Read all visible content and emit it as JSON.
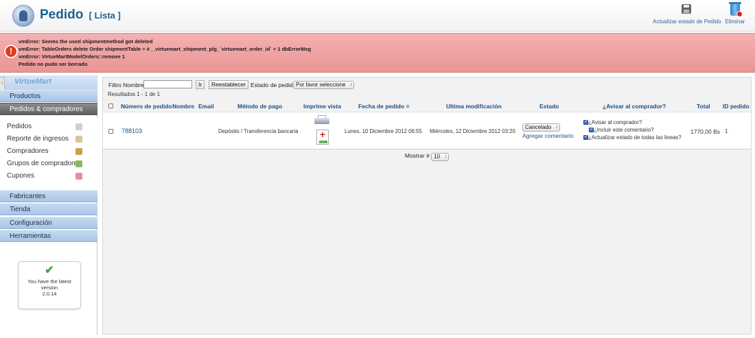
{
  "header": {
    "title": "Pedido",
    "subtitle": "[ Lista ]",
    "toolbar": {
      "update_label": "Actualizar estado de Pedido",
      "delete_label": "Eliminar"
    }
  },
  "errors": {
    "lines": [
      "vmError: Seems the used shipmentmethod got deleted",
      "vmError: TableOrders delete Order shipmentTable = #__virtuemart_shipment_plg_`virtuemart_order_id` = 1 dbErrorMsg",
      "vmError: VirtueMartModelOrders::remove 1",
      "Pedido no pudo ser borrado"
    ],
    "icon": "error-icon"
  },
  "sidebar": {
    "logo_text": "VirtueMart",
    "menus": [
      {
        "label": "Productos"
      },
      {
        "label": "Pedidos & compradores"
      },
      {
        "label": "Fabricantes"
      },
      {
        "label": "Tienda"
      },
      {
        "label": "Configuración"
      },
      {
        "label": "Herramientas"
      }
    ],
    "sub_items": [
      {
        "label": "Pedidos",
        "icon": "orders-icon",
        "color": "#c9c9c9"
      },
      {
        "label": "Reporte de ingresos",
        "icon": "report-icon",
        "color": "#d8c79a"
      },
      {
        "label": "Compradores",
        "icon": "users-icon",
        "color": "#c9a04a"
      },
      {
        "label": "Grupos de compradores",
        "icon": "group-icon",
        "color": "#8fb85a"
      },
      {
        "label": "Cupones",
        "icon": "coupon-icon",
        "color": "#e98aa0"
      }
    ],
    "version_box": {
      "line1": "You have the latest",
      "line2": "version",
      "line3": "2.0.14"
    }
  },
  "filter": {
    "name_label": "Filtro Nombre:",
    "name_value": "",
    "go_button": "Ir",
    "reset_button": "Reestablecer",
    "status_label": "Estado de pedido:",
    "status_value": "Por favor seleccione",
    "results": "Resultados 1 - 1 de 1"
  },
  "table": {
    "headers": [
      "Número de pedido",
      "Nombre",
      "Email",
      "Método de pago",
      "Imprime vista",
      "Fecha de pedido",
      "Ultima modificación",
      "Estado",
      "¿Avisar al comprador?",
      "Total",
      "ID pedido"
    ],
    "row": {
      "order_number": "788103",
      "name": "",
      "email": "",
      "payment": "Depósito / Transferencia bancaria",
      "order_date": "Lunes, 10 Diciembre 2012 06:55",
      "modified": "Miércoles, 12 Diciembre 2012 03:20",
      "status": "Cancelado",
      "add_comment": "Agregar comentario",
      "notify": [
        "¿Avisar al comprador?",
        "¿Incluir este comentario?",
        "¿Actualizar estado de todas las lineas?"
      ],
      "total": "1770,00 Bs",
      "id": "1"
    }
  },
  "pager": {
    "label": "Mostrar #",
    "value": "10"
  }
}
